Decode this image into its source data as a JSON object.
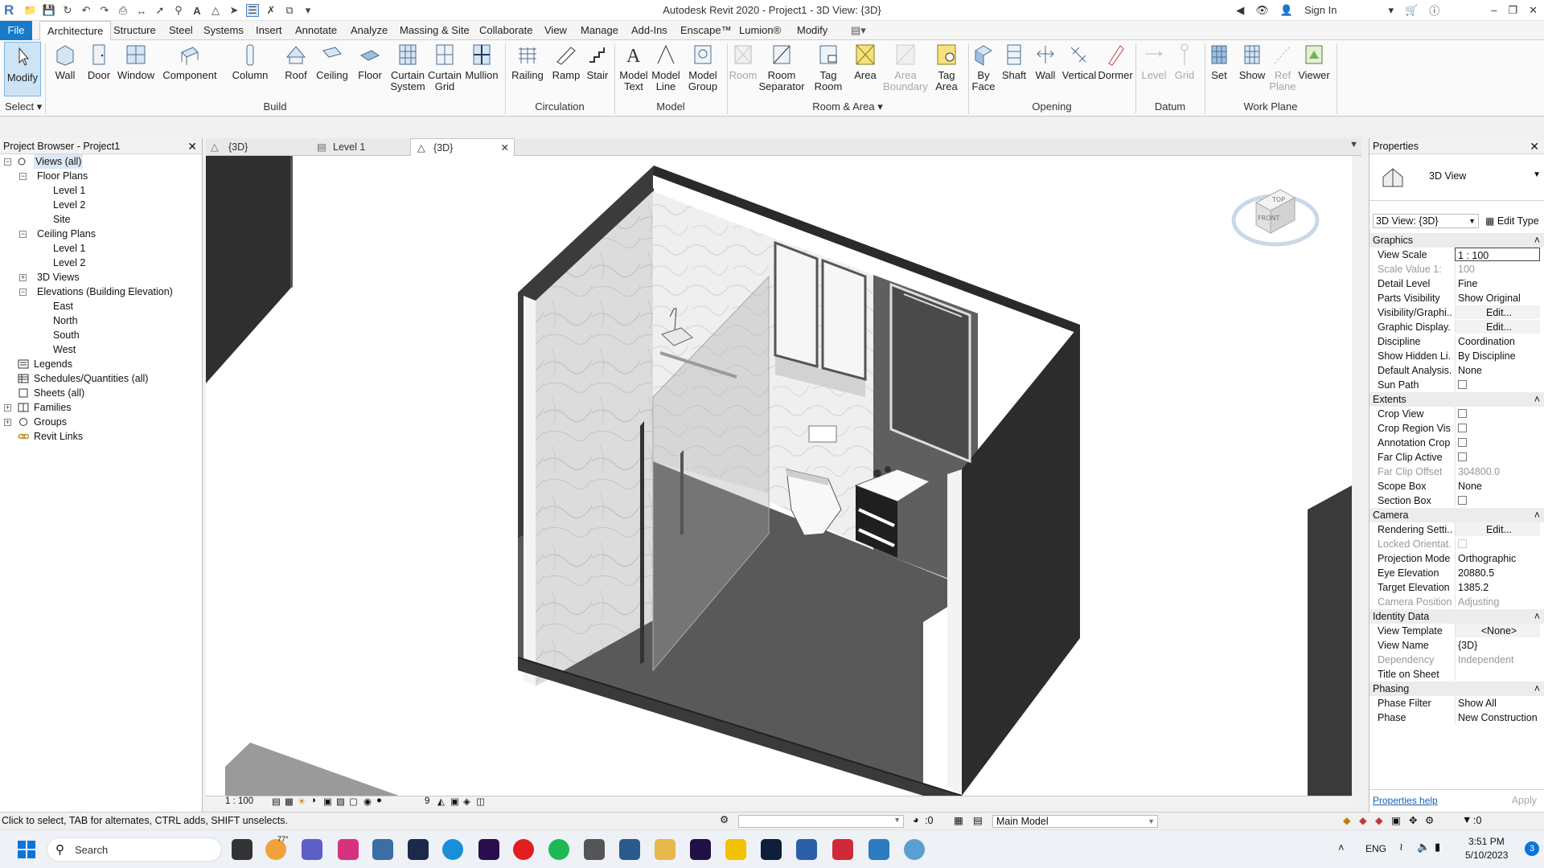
{
  "app": {
    "title": "Autodesk Revit 2020 - Project1 - 3D View: {3D}",
    "sign_in": "Sign In"
  },
  "menu": {
    "file": "File",
    "tabs": [
      "Architecture",
      "Structure",
      "Steel",
      "Systems",
      "Insert",
      "Annotate",
      "Analyze",
      "Massing & Site",
      "Collaborate",
      "View",
      "Manage",
      "Add-Ins",
      "Enscape™",
      "Lumion®",
      "Modify"
    ]
  },
  "ribbon": {
    "select_label": "Select",
    "buttons": [
      {
        "label": "Modify"
      },
      {
        "label": "Wall"
      },
      {
        "label": "Door"
      },
      {
        "label": "Window"
      },
      {
        "label": "Component"
      },
      {
        "label": "Column"
      },
      {
        "label": "Roof"
      },
      {
        "label": "Ceiling"
      },
      {
        "label": "Floor"
      },
      {
        "label": "Curtain System"
      },
      {
        "label": "Curtain Grid"
      },
      {
        "label": "Mullion"
      },
      {
        "label": "Railing"
      },
      {
        "label": "Ramp"
      },
      {
        "label": "Stair"
      },
      {
        "label": "Model Text"
      },
      {
        "label": "Model Line"
      },
      {
        "label": "Model Group"
      },
      {
        "label": "Room"
      },
      {
        "label": "Room Separator"
      },
      {
        "label": "Tag Room"
      },
      {
        "label": "Area"
      },
      {
        "label": "Area Boundary"
      },
      {
        "label": "Tag Area"
      },
      {
        "label": "By Face"
      },
      {
        "label": "Shaft"
      },
      {
        "label": "Wall"
      },
      {
        "label": "Vertical"
      },
      {
        "label": "Dormer"
      },
      {
        "label": "Level"
      },
      {
        "label": "Grid"
      },
      {
        "label": "Set"
      },
      {
        "label": "Show"
      },
      {
        "label": "Ref Plane"
      },
      {
        "label": "Viewer"
      }
    ],
    "panels": [
      "Build",
      "Circulation",
      "Model",
      "Room & Area",
      "Opening",
      "Datum",
      "Work Plane"
    ]
  },
  "project_browser": {
    "title": "Project Browser - Project1",
    "items": [
      "Views (all)",
      "Floor Plans",
      "Level 1",
      "Level 2",
      "Site",
      "Ceiling Plans",
      "Level 1",
      "Level 2",
      "3D Views",
      "Elevations (Building Elevation)",
      "East",
      "North",
      "South",
      "West",
      "Legends",
      "Schedules/Quantities (all)",
      "Sheets (all)",
      "Families",
      "Groups",
      "Revit Links"
    ]
  },
  "view_tabs": [
    "{3D}",
    "Level 1",
    "{3D}"
  ],
  "view_control": {
    "scale": "1 : 100",
    "hidden_count": "9"
  },
  "properties": {
    "title": "Properties",
    "type_name": "3D View",
    "type_selector": "3D View: {3D}",
    "edit_type": "Edit Type",
    "groups": {
      "graphics": "Graphics",
      "extents": "Extents",
      "camera": "Camera",
      "identity": "Identity Data",
      "phasing": "Phasing"
    },
    "rows": [
      {
        "name": "View Scale",
        "value": "1 : 100"
      },
      {
        "name": "Scale Value 1:",
        "value": "100"
      },
      {
        "name": "Detail Level",
        "value": "Fine"
      },
      {
        "name": "Parts Visibility",
        "value": "Show Original"
      },
      {
        "name": "Visibility/Graphi...",
        "value": "Edit..."
      },
      {
        "name": "Graphic Display...",
        "value": "Edit..."
      },
      {
        "name": "Discipline",
        "value": "Coordination"
      },
      {
        "name": "Show Hidden Li...",
        "value": "By Discipline"
      },
      {
        "name": "Default Analysis...",
        "value": "None"
      },
      {
        "name": "Sun Path",
        "value": ""
      },
      {
        "name": "Crop View",
        "value": ""
      },
      {
        "name": "Crop Region Vis...",
        "value": ""
      },
      {
        "name": "Annotation Crop",
        "value": ""
      },
      {
        "name": "Far Clip Active",
        "value": ""
      },
      {
        "name": "Far Clip Offset",
        "value": "304800.0"
      },
      {
        "name": "Scope Box",
        "value": "None"
      },
      {
        "name": "Section Box",
        "value": ""
      },
      {
        "name": "Rendering Setti...",
        "value": "Edit..."
      },
      {
        "name": "Locked Orientat...",
        "value": ""
      },
      {
        "name": "Projection Mode",
        "value": "Orthographic"
      },
      {
        "name": "Eye Elevation",
        "value": "20880.5"
      },
      {
        "name": "Target Elevation",
        "value": "1385.2"
      },
      {
        "name": "Camera Position",
        "value": "Adjusting"
      },
      {
        "name": "View Template",
        "value": "<None>"
      },
      {
        "name": "View Name",
        "value": "{3D}"
      },
      {
        "name": "Dependency",
        "value": "Independent"
      },
      {
        "name": "Title on Sheet",
        "value": ""
      },
      {
        "name": "Phase Filter",
        "value": "Show All"
      },
      {
        "name": "Phase",
        "value": "New Construction"
      }
    ],
    "help": "Properties help",
    "apply": "Apply"
  },
  "viewcube": {
    "top": "TOP",
    "front": "FRONT"
  },
  "status": {
    "hint": "Click to select, TAB for alternates, CTRL adds, SHIFT unselects.",
    "selection_count": ":0",
    "workset": "Main Model",
    "filter_count": ":0"
  },
  "taskbar": {
    "search": "Search",
    "lang": "ENG",
    "time": "3:51 PM",
    "date": "5/10/2023",
    "weather": "77°",
    "notif": "3"
  }
}
